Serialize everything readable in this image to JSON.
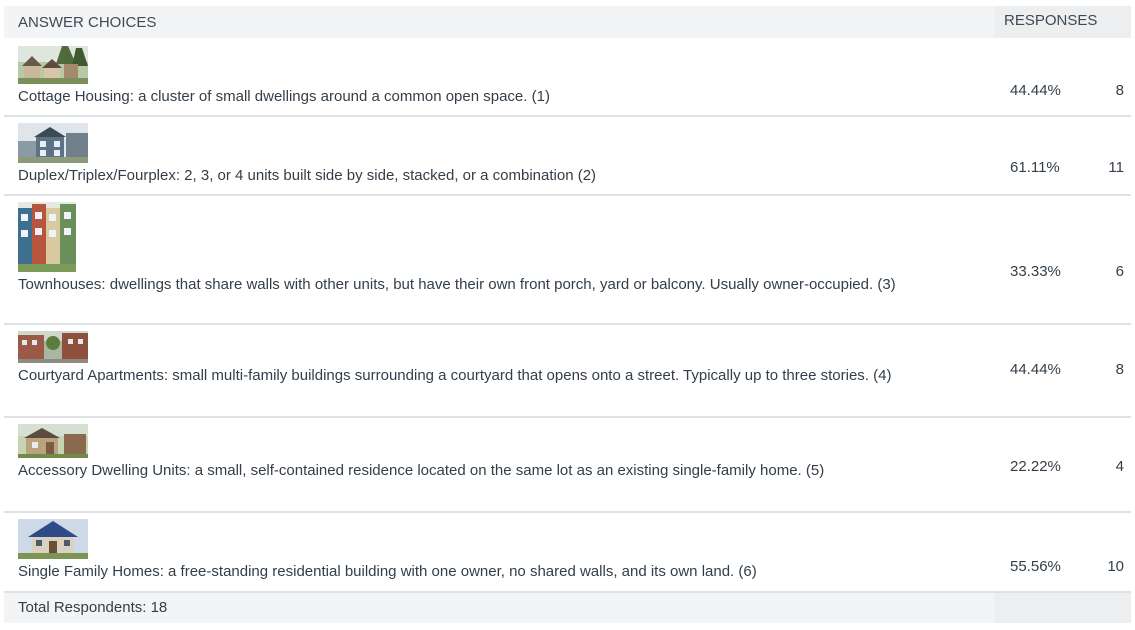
{
  "header": {
    "answer_choices": "ANSWER CHOICES",
    "responses": "RESPONSES"
  },
  "rows": [
    {
      "text": "Cottage Housing: a cluster of small dwellings around a common open space. (1)",
      "percent": "44.44%",
      "count": "8",
      "thumb_icon": "cottage-housing-photo"
    },
    {
      "text": "Duplex/Triplex/Fourplex:  2, 3, or 4 units built side by side, stacked, or a combination (2)",
      "percent": "61.11%",
      "count": "11",
      "thumb_icon": "duplex-photo"
    },
    {
      "text": "Townhouses: dwellings that share walls with other units, but have their own front porch, yard or balcony. Usually owner-occupied. (3)",
      "percent": "33.33%",
      "count": "6",
      "thumb_icon": "townhouses-photo"
    },
    {
      "text": "Courtyard Apartments: small multi-family buildings surrounding a courtyard that opens onto a street. Typically up to three stories. (4)",
      "percent": "44.44%",
      "count": "8",
      "thumb_icon": "courtyard-apartments-photo"
    },
    {
      "text": "Accessory Dwelling Units: a small, self-contained residence located on the same lot as an existing single-family home. (5)",
      "percent": "22.22%",
      "count": "4",
      "thumb_icon": "accessory-dwelling-photo"
    },
    {
      "text": "Single Family Homes:  a free-standing residential building with one owner, no shared walls, and its own land. (6)",
      "percent": "55.56%",
      "count": "10",
      "thumb_icon": "single-family-home-photo"
    }
  ],
  "footer": {
    "total_label": "Total Respondents: 18"
  }
}
